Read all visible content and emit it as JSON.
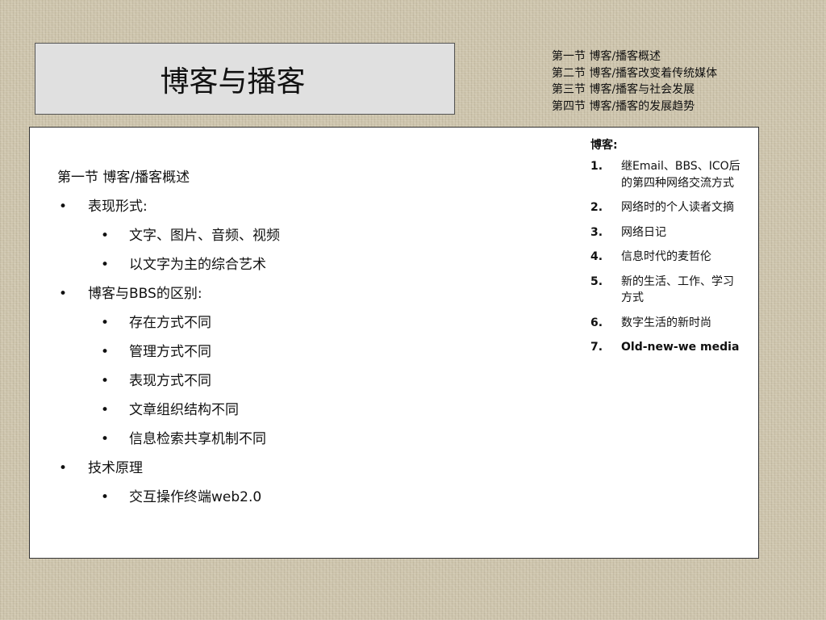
{
  "title": "博客与播客",
  "toc": [
    "第一节 博客/播客概述",
    "第二节 博客/播客改变着传统媒体",
    "第三节 博客/播客与社会发展",
    "第四节 博客/播客的发展趋势"
  ],
  "main": {
    "section_title": "第一节 博客/播客概述",
    "bullet_glyph": "•",
    "items": [
      {
        "text": "表现形式:",
        "subitems": [
          "文字、图片、音频、视频",
          "以文字为主的综合艺术"
        ]
      },
      {
        "text": "博客与BBS的区别:",
        "subitems": [
          "存在方式不同",
          "管理方式不同",
          "表现方式不同",
          "文章组织结构不同",
          "信息检索共享机制不同"
        ]
      },
      {
        "text": "技术原理",
        "subitems": [
          "交互操作终端web2.0"
        ]
      }
    ]
  },
  "side": {
    "heading": "博客:",
    "items": [
      {
        "num": "1.",
        "text": "继Email、BBS、ICO后的第四种网络交流方式"
      },
      {
        "num": "2.",
        "text": "网络时的个人读者文摘"
      },
      {
        "num": "3.",
        "text": "网络日记"
      },
      {
        "num": "4.",
        "text": "信息时代的麦哲伦"
      },
      {
        "num": "5.",
        "text": "新的生活、工作、学习方式"
      },
      {
        "num": "6.",
        "text": "数字生活的新时尚"
      },
      {
        "num": "7.",
        "text": "Old-new-we media"
      }
    ]
  }
}
